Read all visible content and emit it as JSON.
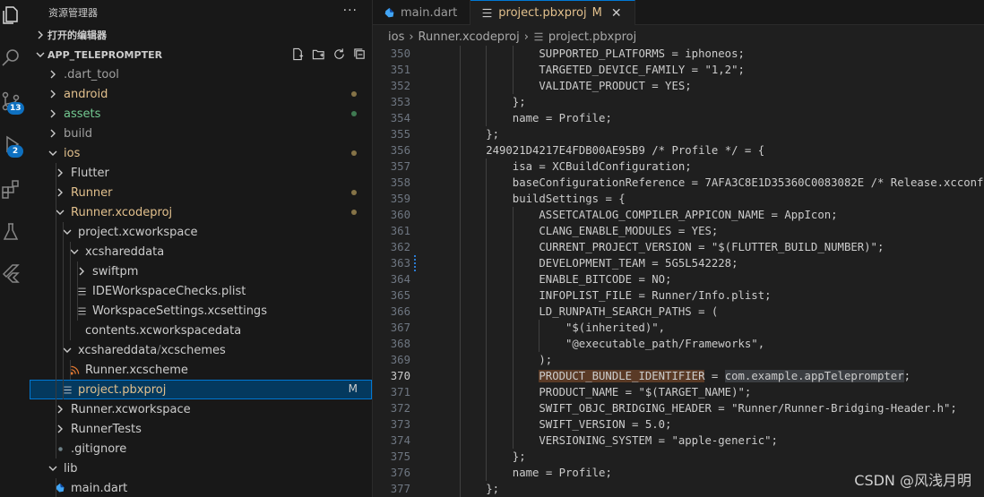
{
  "activity_bar": {
    "source_control_badge": "13",
    "run_debug_badge": "2"
  },
  "sidebar": {
    "title": "资源管理器",
    "more": "···",
    "open_editors": "打开的编辑器",
    "project": "APP_TELEPROMPTER",
    "tree": [
      {
        "label": ".dart_tool",
        "depth": 0,
        "kind": "folder",
        "expanded": false,
        "color": "#a0a0a0",
        "dot": null,
        "flag": ""
      },
      {
        "label": "android",
        "depth": 0,
        "kind": "folder",
        "expanded": false,
        "color": "#e2c08d",
        "dot": "#857347",
        "flag": ""
      },
      {
        "label": "assets",
        "depth": 0,
        "kind": "folder",
        "expanded": false,
        "color": "#73c991",
        "dot": "#3f7a52",
        "flag": ""
      },
      {
        "label": "build",
        "depth": 0,
        "kind": "folder",
        "expanded": false,
        "color": "#a0a0a0",
        "dot": null,
        "flag": ""
      },
      {
        "label": "ios",
        "depth": 0,
        "kind": "folder",
        "expanded": true,
        "color": "#e2c08d",
        "dot": "#857347",
        "flag": ""
      },
      {
        "label": "Flutter",
        "depth": 1,
        "kind": "folder",
        "expanded": false,
        "color": "#cccccc",
        "dot": null,
        "flag": ""
      },
      {
        "label": "Runner",
        "depth": 1,
        "kind": "folder",
        "expanded": false,
        "color": "#e2c08d",
        "dot": "#857347",
        "flag": ""
      },
      {
        "label": "Runner.xcodeproj",
        "depth": 1,
        "kind": "folder",
        "expanded": true,
        "color": "#e2c08d",
        "dot": "#857347",
        "flag": ""
      },
      {
        "label": "project.xcworkspace",
        "depth": 2,
        "kind": "folder",
        "expanded": true,
        "color": "#cccccc",
        "dot": null,
        "flag": ""
      },
      {
        "label": "xcshareddata",
        "depth": 3,
        "kind": "folder",
        "expanded": true,
        "color": "#cccccc",
        "dot": null,
        "flag": ""
      },
      {
        "label": "swiftpm",
        "depth": 4,
        "kind": "folder",
        "expanded": false,
        "color": "#cccccc",
        "dot": null,
        "flag": ""
      },
      {
        "label": "IDEWorkspaceChecks.plist",
        "depth": 4,
        "kind": "list",
        "color": "#cccccc",
        "dot": null,
        "flag": ""
      },
      {
        "label": "WorkspaceSettings.xcsettings",
        "depth": 4,
        "kind": "list",
        "color": "#cccccc",
        "dot": null,
        "flag": ""
      },
      {
        "label": "contents.xcworkspacedata",
        "depth": 3,
        "kind": "plain",
        "color": "#cccccc",
        "dot": null,
        "flag": ""
      },
      {
        "label": "xcshareddata",
        "label2": "xcschemes",
        "depth": 2,
        "kind": "folder",
        "expanded": true,
        "color": "#cccccc",
        "dot": null,
        "flag": ""
      },
      {
        "label": "Runner.xcscheme",
        "depth": 3,
        "kind": "rss",
        "color": "#cccccc",
        "dot": null,
        "flag": ""
      },
      {
        "label": "project.pbxproj",
        "depth": 2,
        "kind": "list",
        "color": "#e2c08d",
        "dot": null,
        "flag": "M",
        "selected": true
      },
      {
        "label": "Runner.xcworkspace",
        "depth": 1,
        "kind": "folder",
        "expanded": false,
        "color": "#cccccc",
        "dot": null,
        "flag": ""
      },
      {
        "label": "RunnerTests",
        "depth": 1,
        "kind": "folder",
        "expanded": false,
        "color": "#cccccc",
        "dot": null,
        "flag": ""
      },
      {
        "label": ".gitignore",
        "depth": 1,
        "kind": "git",
        "color": "#cccccc",
        "dot": null,
        "flag": ""
      },
      {
        "label": "lib",
        "depth": 0,
        "kind": "folder",
        "expanded": true,
        "color": "#cccccc",
        "dot": null,
        "flag": ""
      },
      {
        "label": "main.dart",
        "depth": 1,
        "kind": "dart",
        "color": "#cccccc",
        "dot": null,
        "flag": ""
      }
    ]
  },
  "editor": {
    "tabs": [
      {
        "label": "main.dart",
        "active": false,
        "modified": ""
      },
      {
        "label": "project.pbxproj",
        "active": true,
        "modified": "M"
      }
    ],
    "close_glyph": "✕",
    "breadcrumb": [
      "ios",
      "Runner.xcodeproj",
      "project.pbxproj"
    ],
    "current_line": 370,
    "lines": [
      {
        "n": "350",
        "indent": 4,
        "text": "SUPPORTED_PLATFORMS = iphoneos;"
      },
      {
        "n": "351",
        "indent": 4,
        "text": "TARGETED_DEVICE_FAMILY = \"1,2\";"
      },
      {
        "n": "352",
        "indent": 4,
        "text": "VALIDATE_PRODUCT = YES;"
      },
      {
        "n": "353",
        "indent": 3,
        "text": "};"
      },
      {
        "n": "354",
        "indent": 3,
        "text": "name = Profile;"
      },
      {
        "n": "355",
        "indent": 2,
        "text": "};"
      },
      {
        "n": "356",
        "indent": 2,
        "text": "249021D4217E4FDB00AE95B9 /* Profile */ = {"
      },
      {
        "n": "357",
        "indent": 3,
        "text": "isa = XCBuildConfiguration;"
      },
      {
        "n": "358",
        "indent": 3,
        "text": "baseConfigurationReference = 7AFA3C8E1D35360C0083082E /* Release.xcconfig */;"
      },
      {
        "n": "359",
        "indent": 3,
        "text": "buildSettings = {"
      },
      {
        "n": "360",
        "indent": 4,
        "text": "ASSETCATALOG_COMPILER_APPICON_NAME = AppIcon;"
      },
      {
        "n": "361",
        "indent": 4,
        "text": "CLANG_ENABLE_MODULES = YES;"
      },
      {
        "n": "362",
        "indent": 4,
        "text": "CURRENT_PROJECT_VERSION = \"$(FLUTTER_BUILD_NUMBER)\";"
      },
      {
        "n": "363",
        "indent": 4,
        "text": "DEVELOPMENT_TEAM = 5G5L542228;"
      },
      {
        "n": "364",
        "indent": 4,
        "text": "ENABLE_BITCODE = NO;"
      },
      {
        "n": "365",
        "indent": 4,
        "text": "INFOPLIST_FILE = Runner/Info.plist;"
      },
      {
        "n": "366",
        "indent": 4,
        "text": "LD_RUNPATH_SEARCH_PATHS = ("
      },
      {
        "n": "367",
        "indent": 5,
        "text": "\"$(inherited)\","
      },
      {
        "n": "368",
        "indent": 5,
        "text": "\"@executable_path/Frameworks\","
      },
      {
        "n": "369",
        "indent": 4,
        "text": ");"
      },
      {
        "n": "370",
        "indent": 4,
        "text": "",
        "key": "PRODUCT_BUNDLE_IDENTIFIER",
        "mid": " = ",
        "value": "com.example.appTeleprompter",
        "tail": ";"
      },
      {
        "n": "371",
        "indent": 4,
        "text": "PRODUCT_NAME = \"$(TARGET_NAME)\";"
      },
      {
        "n": "372",
        "indent": 4,
        "text": "SWIFT_OBJC_BRIDGING_HEADER = \"Runner/Runner-Bridging-Header.h\";"
      },
      {
        "n": "373",
        "indent": 4,
        "text": "SWIFT_VERSION = 5.0;"
      },
      {
        "n": "374",
        "indent": 4,
        "text": "VERSIONING_SYSTEM = \"apple-generic\";"
      },
      {
        "n": "375",
        "indent": 3,
        "text": "};"
      },
      {
        "n": "376",
        "indent": 3,
        "text": "name = Profile;"
      },
      {
        "n": "377",
        "indent": 2,
        "text": "};"
      }
    ]
  },
  "watermark": "CSDN @风浅月明"
}
